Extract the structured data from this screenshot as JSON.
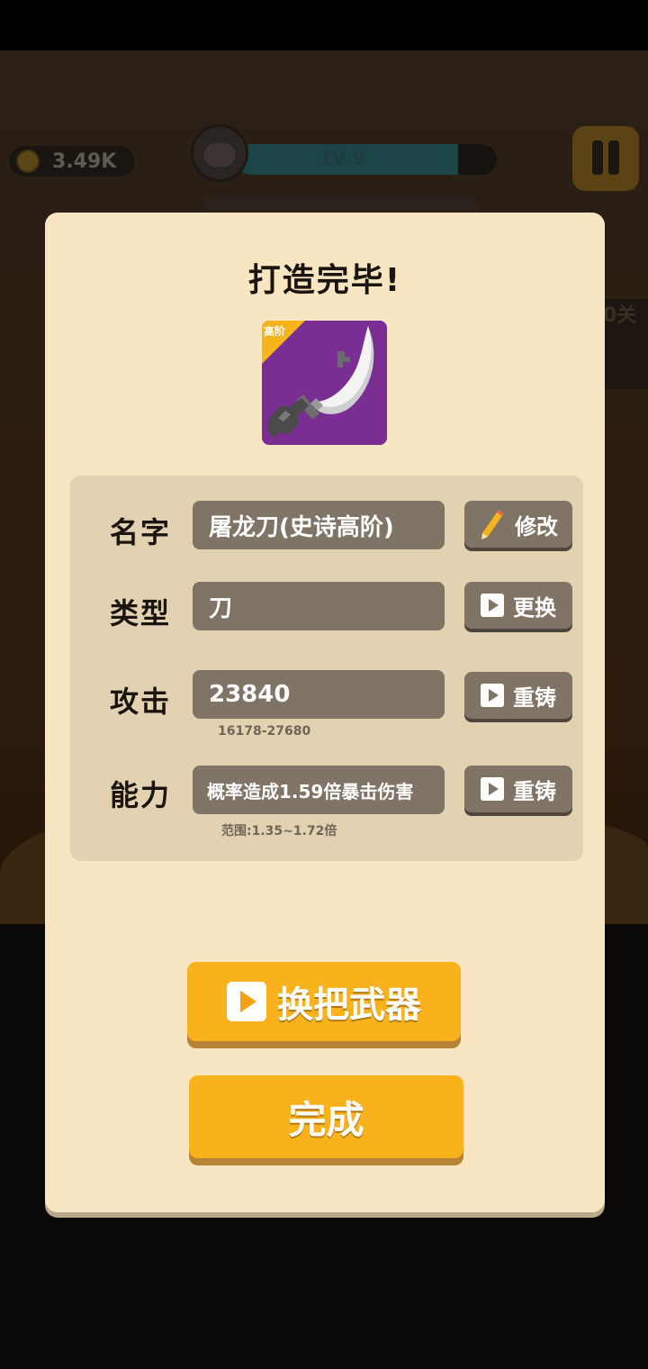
{
  "background": {
    "coins": "3.49K",
    "level": "LV.9",
    "level_progress": 0.85,
    "side_label": "0关"
  },
  "dialog": {
    "title": "打造完毕!",
    "weapon_badge": "高阶",
    "rows": {
      "name": {
        "label": "名字",
        "value": "屠龙刀(史诗高阶)",
        "button": "修改"
      },
      "type": {
        "label": "类型",
        "value": "刀",
        "button": "更换"
      },
      "attack": {
        "label": "攻击",
        "value": "23840",
        "range": "16178-27680",
        "button": "重铸"
      },
      "ability": {
        "label": "能力",
        "value": "概率造成1.59倍暴击伤害",
        "range": "范围:1.35~1.72倍",
        "button": "重铸"
      }
    },
    "swap_weapon_button": "换把武器",
    "done_button": "完成"
  },
  "colors": {
    "dialog_bg": "#f8e6c2",
    "panel_bg": "#e3d2b1",
    "field_bg": "#7f7465",
    "accent": "#f9b11c",
    "weapon_card": "#7a2e93"
  }
}
